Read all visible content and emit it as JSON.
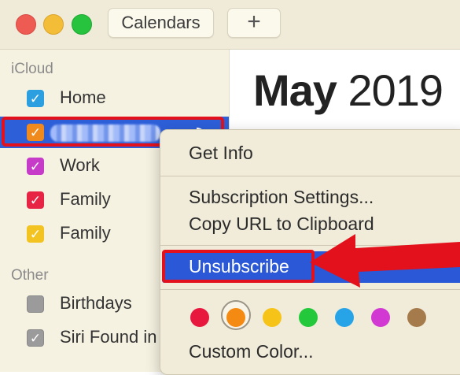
{
  "toolbar": {
    "calendars_label": "Calendars",
    "add_label": "+"
  },
  "sidebar": {
    "icloud_label": "iCloud",
    "other_label": "Other",
    "icloud_items": [
      {
        "label": "Home",
        "color": "#2b9fe0",
        "checked": true
      },
      {
        "label": "",
        "color": "#f08a1c",
        "checked": true,
        "selected": true,
        "subscribed": true
      },
      {
        "label": "Work",
        "color": "#c73bc9",
        "checked": true
      },
      {
        "label": "Family",
        "color": "#e82445",
        "checked": true
      },
      {
        "label": "Family",
        "color": "#f3c322",
        "checked": true
      }
    ],
    "other_items": [
      {
        "label": "Birthdays",
        "checked": false
      },
      {
        "label": "Siri Found in",
        "checked": true
      }
    ]
  },
  "main": {
    "month": "May",
    "year": "2019"
  },
  "context_menu": {
    "get_info": "Get Info",
    "subscription_settings": "Subscription Settings...",
    "copy_url": "Copy URL to Clipboard",
    "unsubscribe": "Unsubscribe",
    "custom_color": "Custom Color...",
    "colors": [
      "#e8173e",
      "#f58a12",
      "#f6c319",
      "#23c93a",
      "#27a4e8",
      "#d139d2",
      "#a67b4c"
    ],
    "selected_color_index": 1
  },
  "colors": {
    "selection": "#2a58d6",
    "highlight": "#e3111b"
  }
}
